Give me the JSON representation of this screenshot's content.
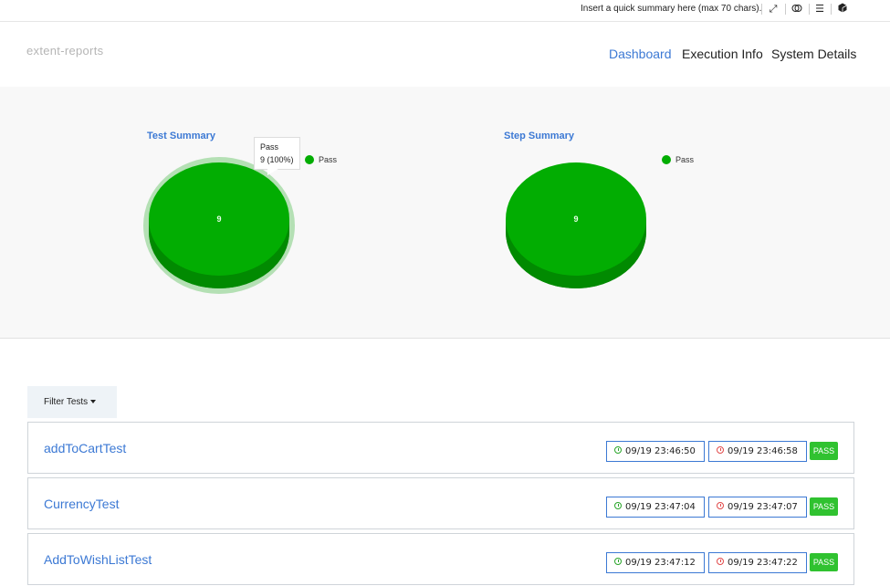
{
  "topbar": {
    "summary": "Insert a quick summary here (max 70 chars).",
    "icons": [
      "expand-icon",
      "toggle-icon",
      "menu-icon",
      "cube-icon"
    ]
  },
  "header": {
    "brand": "extent-reports",
    "nav": [
      {
        "label": "Dashboard",
        "active": true
      },
      {
        "label": "Execution Info",
        "active": false
      },
      {
        "label": "System Details",
        "active": false
      }
    ]
  },
  "colors": {
    "accent": "#3c79d4",
    "pass": "#02ad02",
    "pass_dark": "#018a01",
    "badge": "#30c230"
  },
  "chart_data": [
    {
      "type": "pie",
      "title": "Test Summary",
      "categories": [
        "Pass"
      ],
      "values": [
        9
      ],
      "legend": "top-right",
      "tooltip": {
        "label": "Pass",
        "value": "9 (100%)"
      }
    },
    {
      "type": "pie",
      "title": "Step Summary",
      "categories": [
        "Pass"
      ],
      "values": [
        9
      ],
      "legend": "top-right"
    }
  ],
  "filter": {
    "label": "Filter Tests"
  },
  "tests": [
    {
      "name": "addToCartTest",
      "start": "09/19 23:46:50",
      "end": "09/19 23:46:58",
      "status": "PASS"
    },
    {
      "name": "CurrencyTest",
      "start": "09/19 23:47:04",
      "end": "09/19 23:47:07",
      "status": "PASS"
    },
    {
      "name": "AddToWishListTest",
      "start": "09/19 23:47:12",
      "end": "09/19 23:47:22",
      "status": "PASS"
    }
  ]
}
